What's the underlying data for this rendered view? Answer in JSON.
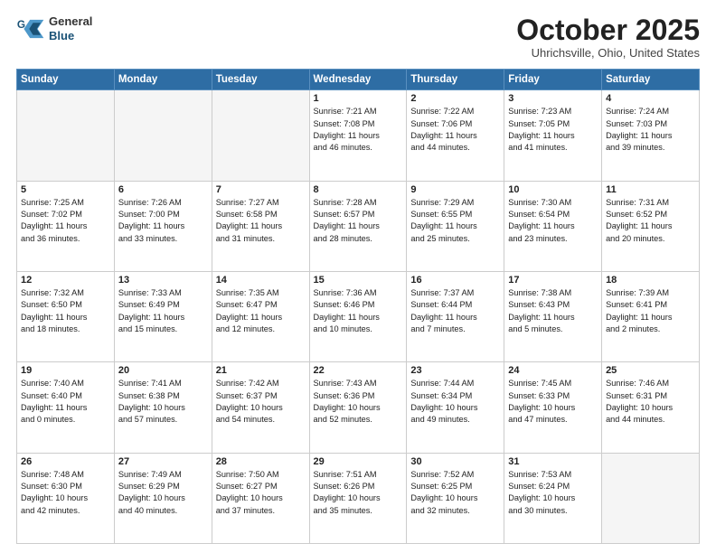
{
  "header": {
    "logo_line1": "General",
    "logo_line2": "Blue",
    "month": "October 2025",
    "location": "Uhrichsville, Ohio, United States"
  },
  "weekdays": [
    "Sunday",
    "Monday",
    "Tuesday",
    "Wednesday",
    "Thursday",
    "Friday",
    "Saturday"
  ],
  "weeks": [
    [
      {
        "day": "",
        "info": ""
      },
      {
        "day": "",
        "info": ""
      },
      {
        "day": "",
        "info": ""
      },
      {
        "day": "1",
        "info": "Sunrise: 7:21 AM\nSunset: 7:08 PM\nDaylight: 11 hours\nand 46 minutes."
      },
      {
        "day": "2",
        "info": "Sunrise: 7:22 AM\nSunset: 7:06 PM\nDaylight: 11 hours\nand 44 minutes."
      },
      {
        "day": "3",
        "info": "Sunrise: 7:23 AM\nSunset: 7:05 PM\nDaylight: 11 hours\nand 41 minutes."
      },
      {
        "day": "4",
        "info": "Sunrise: 7:24 AM\nSunset: 7:03 PM\nDaylight: 11 hours\nand 39 minutes."
      }
    ],
    [
      {
        "day": "5",
        "info": "Sunrise: 7:25 AM\nSunset: 7:02 PM\nDaylight: 11 hours\nand 36 minutes."
      },
      {
        "day": "6",
        "info": "Sunrise: 7:26 AM\nSunset: 7:00 PM\nDaylight: 11 hours\nand 33 minutes."
      },
      {
        "day": "7",
        "info": "Sunrise: 7:27 AM\nSunset: 6:58 PM\nDaylight: 11 hours\nand 31 minutes."
      },
      {
        "day": "8",
        "info": "Sunrise: 7:28 AM\nSunset: 6:57 PM\nDaylight: 11 hours\nand 28 minutes."
      },
      {
        "day": "9",
        "info": "Sunrise: 7:29 AM\nSunset: 6:55 PM\nDaylight: 11 hours\nand 25 minutes."
      },
      {
        "day": "10",
        "info": "Sunrise: 7:30 AM\nSunset: 6:54 PM\nDaylight: 11 hours\nand 23 minutes."
      },
      {
        "day": "11",
        "info": "Sunrise: 7:31 AM\nSunset: 6:52 PM\nDaylight: 11 hours\nand 20 minutes."
      }
    ],
    [
      {
        "day": "12",
        "info": "Sunrise: 7:32 AM\nSunset: 6:50 PM\nDaylight: 11 hours\nand 18 minutes."
      },
      {
        "day": "13",
        "info": "Sunrise: 7:33 AM\nSunset: 6:49 PM\nDaylight: 11 hours\nand 15 minutes."
      },
      {
        "day": "14",
        "info": "Sunrise: 7:35 AM\nSunset: 6:47 PM\nDaylight: 11 hours\nand 12 minutes."
      },
      {
        "day": "15",
        "info": "Sunrise: 7:36 AM\nSunset: 6:46 PM\nDaylight: 11 hours\nand 10 minutes."
      },
      {
        "day": "16",
        "info": "Sunrise: 7:37 AM\nSunset: 6:44 PM\nDaylight: 11 hours\nand 7 minutes."
      },
      {
        "day": "17",
        "info": "Sunrise: 7:38 AM\nSunset: 6:43 PM\nDaylight: 11 hours\nand 5 minutes."
      },
      {
        "day": "18",
        "info": "Sunrise: 7:39 AM\nSunset: 6:41 PM\nDaylight: 11 hours\nand 2 minutes."
      }
    ],
    [
      {
        "day": "19",
        "info": "Sunrise: 7:40 AM\nSunset: 6:40 PM\nDaylight: 11 hours\nand 0 minutes."
      },
      {
        "day": "20",
        "info": "Sunrise: 7:41 AM\nSunset: 6:38 PM\nDaylight: 10 hours\nand 57 minutes."
      },
      {
        "day": "21",
        "info": "Sunrise: 7:42 AM\nSunset: 6:37 PM\nDaylight: 10 hours\nand 54 minutes."
      },
      {
        "day": "22",
        "info": "Sunrise: 7:43 AM\nSunset: 6:36 PM\nDaylight: 10 hours\nand 52 minutes."
      },
      {
        "day": "23",
        "info": "Sunrise: 7:44 AM\nSunset: 6:34 PM\nDaylight: 10 hours\nand 49 minutes."
      },
      {
        "day": "24",
        "info": "Sunrise: 7:45 AM\nSunset: 6:33 PM\nDaylight: 10 hours\nand 47 minutes."
      },
      {
        "day": "25",
        "info": "Sunrise: 7:46 AM\nSunset: 6:31 PM\nDaylight: 10 hours\nand 44 minutes."
      }
    ],
    [
      {
        "day": "26",
        "info": "Sunrise: 7:48 AM\nSunset: 6:30 PM\nDaylight: 10 hours\nand 42 minutes."
      },
      {
        "day": "27",
        "info": "Sunrise: 7:49 AM\nSunset: 6:29 PM\nDaylight: 10 hours\nand 40 minutes."
      },
      {
        "day": "28",
        "info": "Sunrise: 7:50 AM\nSunset: 6:27 PM\nDaylight: 10 hours\nand 37 minutes."
      },
      {
        "day": "29",
        "info": "Sunrise: 7:51 AM\nSunset: 6:26 PM\nDaylight: 10 hours\nand 35 minutes."
      },
      {
        "day": "30",
        "info": "Sunrise: 7:52 AM\nSunset: 6:25 PM\nDaylight: 10 hours\nand 32 minutes."
      },
      {
        "day": "31",
        "info": "Sunrise: 7:53 AM\nSunset: 6:24 PM\nDaylight: 10 hours\nand 30 minutes."
      },
      {
        "day": "",
        "info": ""
      }
    ]
  ]
}
